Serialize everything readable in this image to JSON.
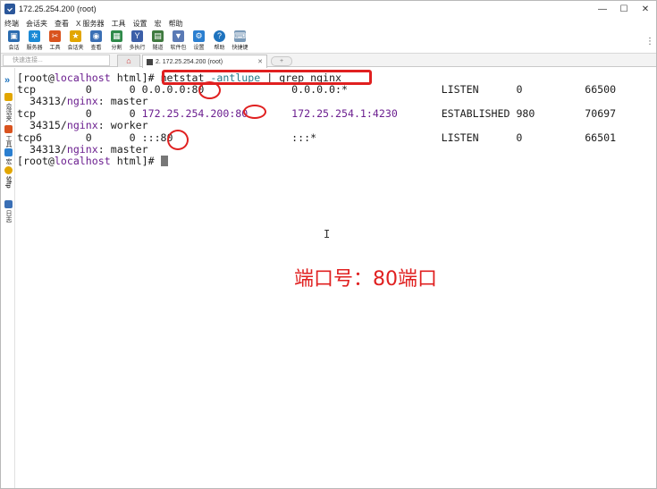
{
  "window": {
    "title": "172.25.254.200 (root)",
    "controls": [
      "—",
      "☐",
      "✕"
    ]
  },
  "menubar": {
    "items": [
      "终端",
      "会话夹",
      "查看",
      "X 服务器",
      "工具",
      "设置",
      "宏",
      "帮助"
    ]
  },
  "toolbar": {
    "items": [
      {
        "label": "会话",
        "icon": "session-icon",
        "color": "#2b6cb0"
      },
      {
        "label": "服务器",
        "icon": "servers-icon",
        "color": "#1b8ad6"
      },
      {
        "label": "工具",
        "icon": "tools-icon",
        "color": "#d9531e"
      },
      {
        "label": "会话夹",
        "icon": "star-icon",
        "color": "#e2a600"
      },
      {
        "label": "查看",
        "icon": "view-icon",
        "color": "#3a6fb5"
      },
      {
        "label": "分割",
        "icon": "split-icon",
        "color": "#2f8a4a"
      },
      {
        "label": "多执行",
        "icon": "multiexec-icon",
        "color": "#3c5fa8"
      },
      {
        "label": "隧道",
        "icon": "tunnel-icon",
        "color": "#3f7a3f"
      },
      {
        "label": "软件包",
        "icon": "packages-icon",
        "color": "#5a7ab5"
      },
      {
        "label": "设置",
        "icon": "gear-icon",
        "color": "#2b7fd0"
      },
      {
        "label": "帮助",
        "icon": "help-icon",
        "color": "#1e73be"
      },
      {
        "label": "快捷键",
        "icon": "keyboard-icon",
        "color": "#7a9ab8"
      }
    ]
  },
  "tabs": {
    "quick_connect_placeholder": "快速连接...",
    "home_glyph": "⌂",
    "session_tab_label": "2. 172.25.254.200 (root)",
    "session_tab_close": "✕",
    "new_tab_glyph": "+"
  },
  "sidebar": {
    "toggle": "»",
    "items": [
      {
        "label": "会话夹",
        "color": "#e2a600"
      },
      {
        "label": "工具",
        "color": "#d9531e"
      },
      {
        "label": "宏",
        "color": "#2b7fd0"
      },
      {
        "label": "Sftp",
        "color": "#e2a600"
      },
      {
        "label": "日志",
        "color": "#3a6fb5"
      }
    ]
  },
  "terminal": {
    "prompt1": {
      "p1": "[root@",
      "host": "localhost",
      "p2": " html]# ",
      "cmd_a": "netstat ",
      "cmd_b": "-antlupe",
      "cmd_c": " | grep nginx"
    },
    "rows": [
      {
        "a": "tcp        0      0 ",
        "local": "0.0.0.0:80",
        "gap": "              ",
        "foreign": "0.0.0.0:*",
        "rest": "               LISTEN      0          66500"
      },
      {
        "indent": "  34313/",
        "proc": "nginx",
        "tail": ": master"
      },
      {
        "a": "tcp        0      0 ",
        "local": "172.25.254.200:80",
        "gap": "       ",
        "foreign": "172.25.254.1:4230",
        "rest": "       ESTABLISHED 980        70697"
      },
      {
        "indent": "  34315/",
        "proc": "nginx",
        "tail": ": worker"
      },
      {
        "a": "tcp6       0      0 ",
        "local": ":::80",
        "gap": "                   ",
        "foreign": ":::*",
        "rest": "                    LISTEN      0          66501"
      },
      {
        "indent": "  34313/",
        "proc": "nginx",
        "tail": ": master"
      }
    ],
    "prompt2": {
      "p1": "[root@",
      "host": "localhost",
      "p2": " html]# "
    }
  },
  "annotation": {
    "text": "端口号：80端口",
    "color": "#e02020"
  }
}
